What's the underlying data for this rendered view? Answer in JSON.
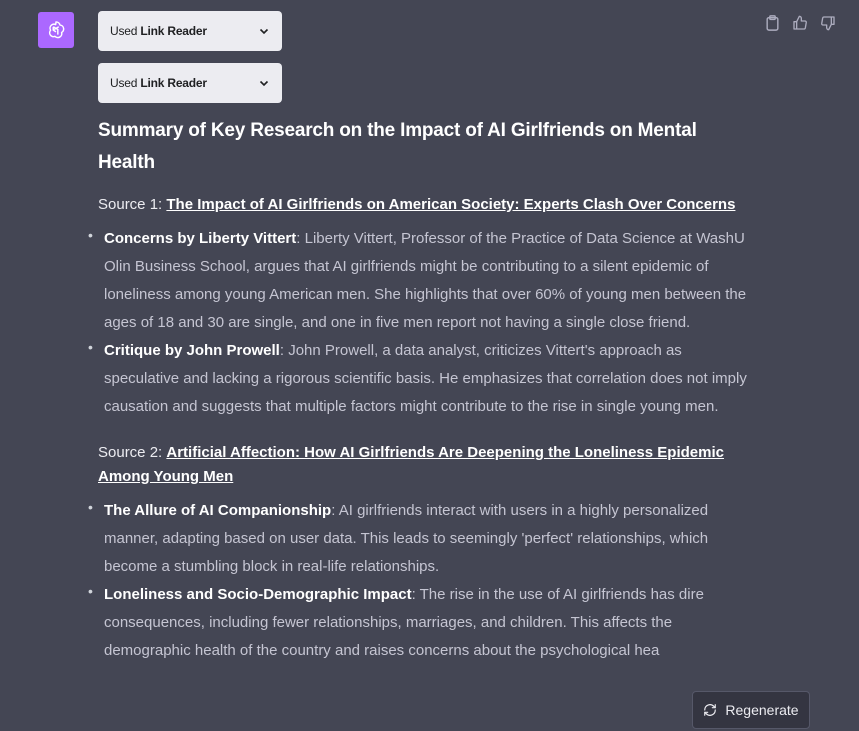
{
  "plugins": [
    {
      "prefix": "Used",
      "name": "Link Reader"
    },
    {
      "prefix": "Used",
      "name": "Link Reader"
    }
  ],
  "title": "Summary of Key Research on the Impact of AI Girlfriends on Mental Health",
  "sources": [
    {
      "label": "Source 1:",
      "link": "The Impact of AI Girlfriends on American Society: Experts Clash Over Concerns",
      "bullets": [
        {
          "head": "Concerns by Liberty Vittert",
          "body": ": Liberty Vittert, Professor of the Practice of Data Science at WashU Olin Business School, argues that AI girlfriends might be contributing to a silent epidemic of loneliness among young American men. She highlights that over 60% of young men between the ages of 18 and 30 are single, and one in five men report not having a single close friend."
        },
        {
          "head": "Critique by John Prowell",
          "body": ": John Prowell, a data analyst, criticizes Vittert's approach as speculative and lacking a rigorous scientific basis. He emphasizes that correlation does not imply causation and suggests that multiple factors might contribute to the rise in single young men."
        }
      ]
    },
    {
      "label": "Source 2:",
      "link": "Artificial Affection: How AI Girlfriends Are Deepening the Loneliness Epidemic Among Young Men",
      "bullets": [
        {
          "head": "The Allure of AI Companionship",
          "body": ": AI girlfriends interact with users in a highly personalized manner, adapting based on user data. This leads to seemingly 'perfect' relationships, which become a stumbling block in real-life relationships."
        },
        {
          "head": "Loneliness and Socio-Demographic Impact",
          "body": ": The rise in the use of AI girlfriends has dire consequences, including fewer relationships, marriages, and children. This affects the demographic health of the country and raises concerns about the psychological hea"
        }
      ]
    }
  ],
  "regenerate_label": "Regenerate",
  "icons": {
    "avatar": "openai-logo-icon",
    "copy": "clipboard-icon",
    "like": "thumbs-up-icon",
    "dislike": "thumbs-down-icon",
    "regenerate": "refresh-icon",
    "expand": "chevron-down-icon"
  },
  "colors": {
    "background": "#444654",
    "avatar": "#ab68ff",
    "pill": "#ececf1",
    "regenerate_bg": "#343541"
  }
}
